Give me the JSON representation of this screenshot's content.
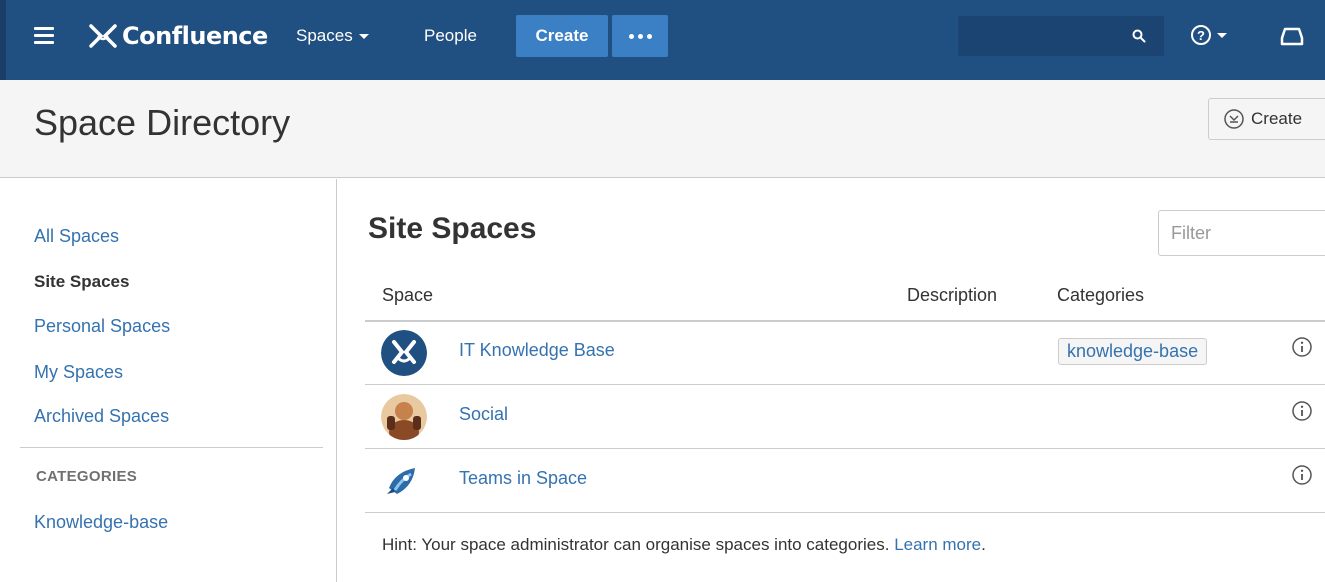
{
  "nav": {
    "brand": "Confluence",
    "spaces_label": "Spaces",
    "people_label": "People",
    "create_label": "Create",
    "search_placeholder": ""
  },
  "header": {
    "title": "Space Directory",
    "create_space_label": "Create"
  },
  "sidebar": {
    "links": [
      {
        "label": "All Spaces",
        "active": false
      },
      {
        "label": "Site Spaces",
        "active": true
      },
      {
        "label": "Personal Spaces",
        "active": false
      },
      {
        "label": "My Spaces",
        "active": false
      },
      {
        "label": "Archived Spaces",
        "active": false
      }
    ],
    "categories_heading": "CATEGORIES",
    "categories": [
      {
        "label": "Knowledge-base"
      }
    ]
  },
  "main": {
    "title": "Site Spaces",
    "filter_placeholder": "Filter",
    "columns": {
      "space": "Space",
      "description": "Description",
      "categories": "Categories"
    },
    "rows": [
      {
        "name": "IT Knowledge Base",
        "description": "",
        "category": "knowledge-base",
        "icon": "confluence-logo-icon"
      },
      {
        "name": "Social",
        "description": "",
        "category": "",
        "icon": "social-avatar-icon"
      },
      {
        "name": "Teams in Space",
        "description": "",
        "category": "",
        "icon": "rocket-icon"
      }
    ],
    "hint_text": "Hint: Your space administrator can organise spaces into categories.",
    "hint_link": "Learn more",
    "hint_end": "."
  },
  "colors": {
    "nav_bg": "#205081",
    "button_bg": "#3b7fc4",
    "link": "#3572b0"
  }
}
